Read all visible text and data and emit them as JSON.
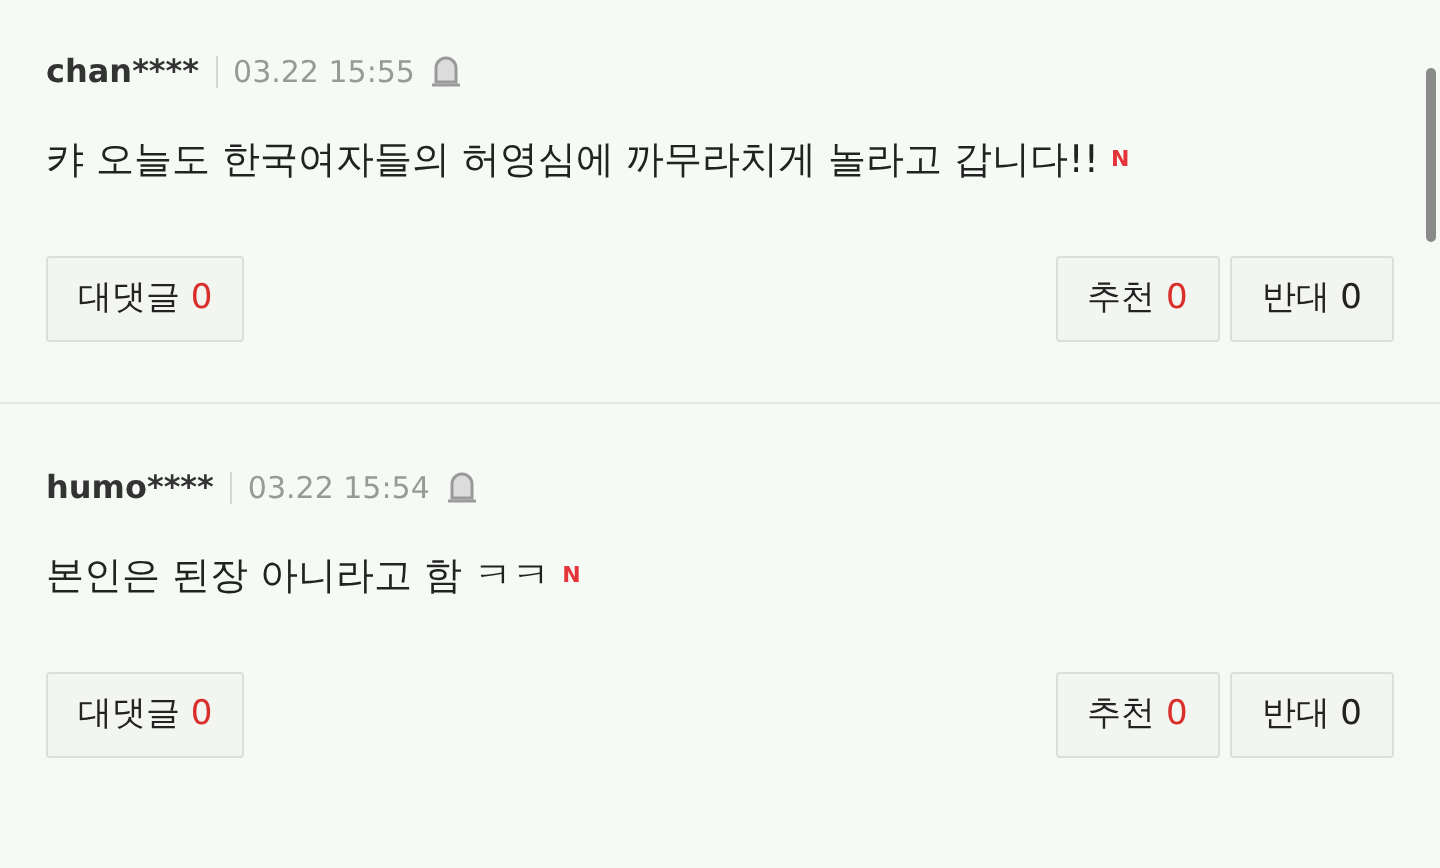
{
  "comments": [
    {
      "author": "chan****",
      "time": "03.22 15:55",
      "text": "캬 오늘도 한국여자들의 허영심에 까무라치게 놀라고 갑니다!!",
      "new_badge": "N",
      "reply": {
        "label": "대댓글",
        "count": "0"
      },
      "like": {
        "label": "추천",
        "count": "0"
      },
      "dislike": {
        "label": "반대",
        "count": "0"
      }
    },
    {
      "author": "humo****",
      "time": "03.22 15:54",
      "text": "본인은 된장 아니라고 함 ㅋㅋ",
      "new_badge": "N",
      "reply": {
        "label": "대댓글",
        "count": "0"
      },
      "like": {
        "label": "추천",
        "count": "0"
      },
      "dislike": {
        "label": "반대",
        "count": "0"
      }
    }
  ]
}
